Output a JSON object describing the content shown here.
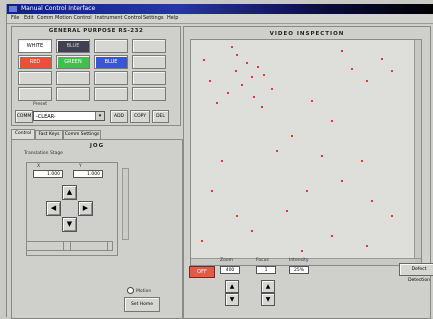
{
  "window": {
    "title": "Manual Control Interface"
  },
  "menu": [
    "File",
    "Edit",
    "Comm",
    "Motion Control",
    "Instrument Control",
    "Settings",
    "Help"
  ],
  "general_purpose": {
    "title": "GENERAL PURPOSE RS-232",
    "buttons": [
      {
        "label": "WHITE",
        "color": "#ffffff",
        "text_color": "#111111"
      },
      {
        "label": "BLUE",
        "color": "#404050",
        "text_color": "#cfcfcf"
      },
      {
        "label": "RED",
        "color": "#e8503a",
        "text_color": "#ffffff"
      },
      {
        "label": "GREEN",
        "color": "#3ec14a",
        "text_color": "#ffffff"
      },
      {
        "label": "BLUE",
        "color": "#3a56d6",
        "text_color": "#ffffff"
      }
    ],
    "preset_label": "Preset",
    "preset_value": "-CLEAR-",
    "comm_label": "COMM",
    "add_label": "ADD",
    "copy_label": "COPY",
    "del_label": "DEL"
  },
  "tabs": [
    {
      "label": "Control"
    },
    {
      "label": "Fast Keys"
    },
    {
      "label": "Comm Settings"
    }
  ],
  "jog": {
    "title": "JOG",
    "translation_label": "Translation Stage",
    "x_label": "X",
    "y_label": "Y",
    "x_value": "1.000",
    "y_value": "1.000",
    "motion_label": "Motion",
    "set_home_label": "Set Home"
  },
  "video": {
    "title": "VIDEO INSPECTION",
    "start_label": "OFF",
    "zoom_label": "Zoom",
    "zoom_value": "400",
    "focus_label": "Focus",
    "focus_value": "1",
    "intensity_label": "Intensity",
    "intensity_value": "25%",
    "detect_label": "Defect Detection",
    "defect_color": "#e83535"
  }
}
